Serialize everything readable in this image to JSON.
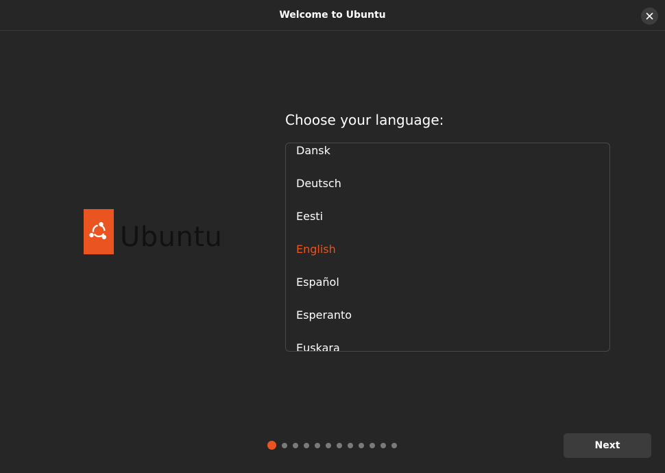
{
  "window": {
    "title": "Welcome to Ubuntu"
  },
  "logo": {
    "text": "Ubuntu"
  },
  "main": {
    "heading": "Choose your language:",
    "languages": [
      {
        "label": "Dansk",
        "selected": false
      },
      {
        "label": "Deutsch",
        "selected": false
      },
      {
        "label": "Eesti",
        "selected": false
      },
      {
        "label": "English",
        "selected": true
      },
      {
        "label": "Español",
        "selected": false
      },
      {
        "label": "Esperanto",
        "selected": false
      },
      {
        "label": "Euskara",
        "selected": false
      }
    ]
  },
  "pager": {
    "total_pages": 12,
    "current_page": 1
  },
  "footer": {
    "next_label": "Next"
  },
  "colors": {
    "accent": "#e95420",
    "background": "#262626"
  },
  "icons": {
    "close": "close-icon",
    "logo": "ubuntu-logo-icon"
  }
}
